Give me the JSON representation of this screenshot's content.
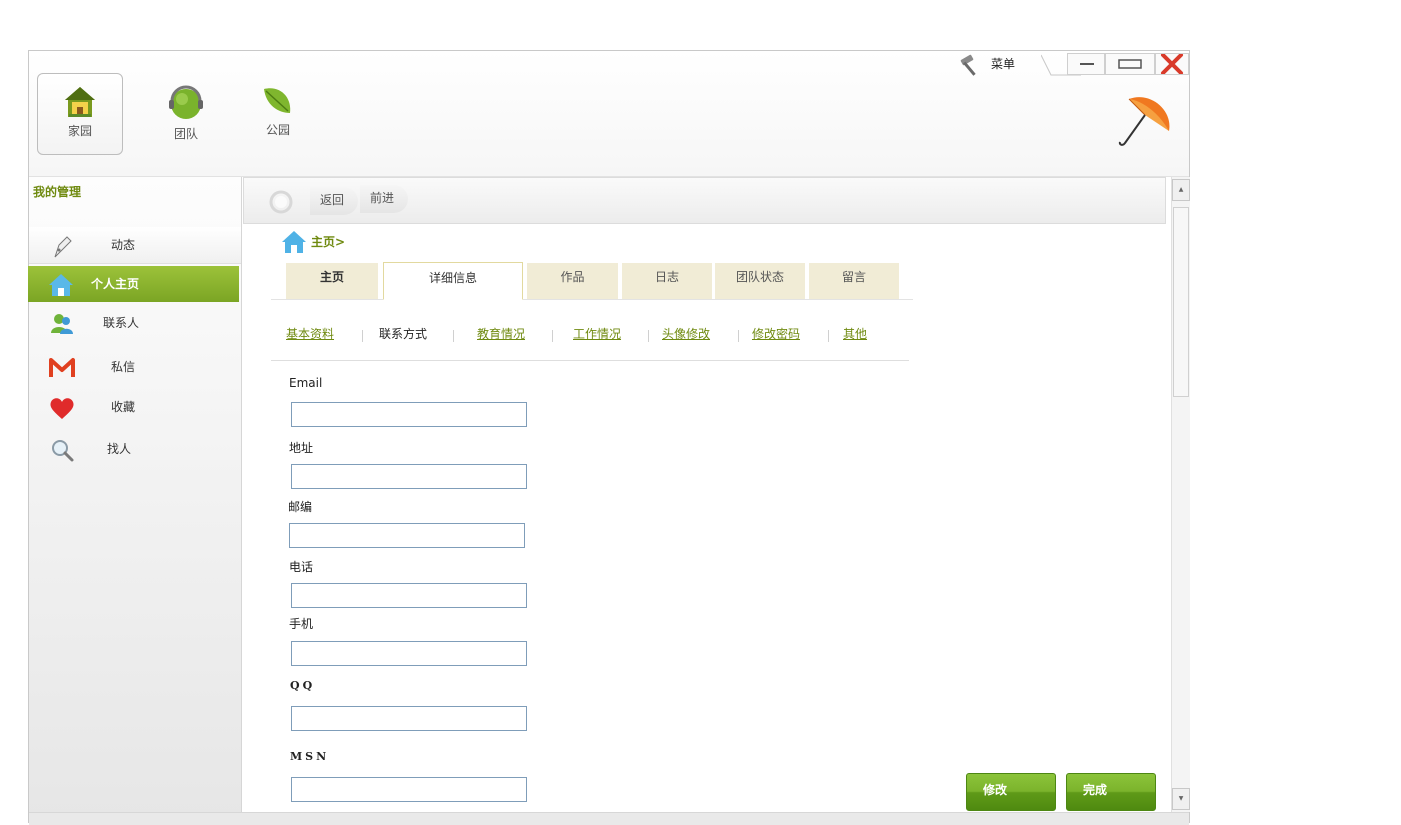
{
  "header": {
    "nav": [
      {
        "label": "家园"
      },
      {
        "label": "团队"
      },
      {
        "label": "公园"
      }
    ],
    "menu_label": "菜单"
  },
  "sidebar": {
    "title": "我的管理",
    "items": [
      {
        "label": "动态"
      },
      {
        "label": "个人主页"
      },
      {
        "label": "联系人"
      },
      {
        "label": "私信"
      },
      {
        "label": "收藏"
      },
      {
        "label": "找人"
      }
    ]
  },
  "toolbar": {
    "back_label": "返回",
    "forward_label": "前进"
  },
  "breadcrumb": {
    "text": "主页>"
  },
  "tabs": [
    {
      "label": "主页"
    },
    {
      "label": "详细信息"
    },
    {
      "label": "作品"
    },
    {
      "label": "日志"
    },
    {
      "label": "团队状态"
    },
    {
      "label": "留言"
    }
  ],
  "subtabs": [
    {
      "label": "基本资料"
    },
    {
      "label": "联系方式"
    },
    {
      "label": "教育情况"
    },
    {
      "label": "工作情况"
    },
    {
      "label": "头像修改"
    },
    {
      "label": "修改密码"
    },
    {
      "label": "其他"
    }
  ],
  "form": {
    "fields": [
      {
        "label": "Email",
        "value": ""
      },
      {
        "label": "地址",
        "value": ""
      },
      {
        "label": "邮编",
        "value": ""
      },
      {
        "label": "电话",
        "value": ""
      },
      {
        "label": "手机",
        "value": ""
      },
      {
        "label": "QQ",
        "value": ""
      },
      {
        "label": "MSN",
        "value": ""
      }
    ]
  },
  "actions": {
    "modify_label": "修改",
    "done_label": "完成"
  },
  "colors": {
    "accent_green": "#7ba524",
    "link_green": "#6f8a10",
    "tab_bg": "#f1ecd6"
  }
}
